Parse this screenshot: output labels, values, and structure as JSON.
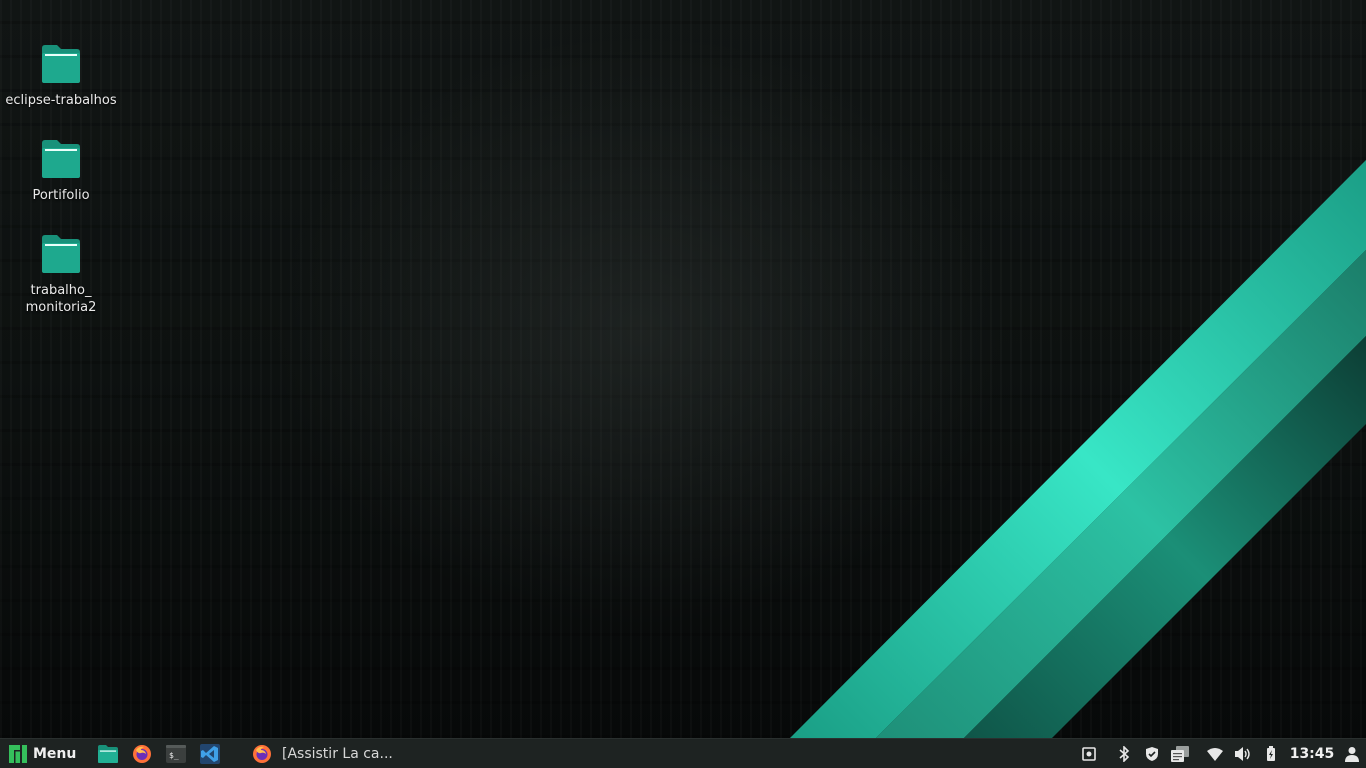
{
  "desktop": {
    "icons": [
      {
        "label": "eclipse-trabalhos",
        "icon": "folder-icon"
      },
      {
        "label": "Portifolio",
        "icon": "folder-icon"
      },
      {
        "label": "trabalho_\nmonitoria2",
        "icon": "folder-icon"
      }
    ]
  },
  "taskbar": {
    "menu_label": "Menu",
    "launchers": [
      {
        "icon": "file-manager-icon"
      },
      {
        "icon": "firefox-icon"
      },
      {
        "icon": "terminal-icon"
      },
      {
        "icon": "vscode-icon"
      }
    ],
    "window_task": {
      "label": "[Assistir La ca...",
      "icon": "firefox-icon"
    },
    "tray": [
      {
        "icon": "screenshot-icon"
      },
      {
        "icon": "bluetooth-icon"
      },
      {
        "icon": "shield-icon"
      },
      {
        "icon": "clipboard-icon"
      },
      {
        "icon": "wifi-icon"
      },
      {
        "icon": "volume-icon"
      },
      {
        "icon": "battery-icon"
      }
    ],
    "clock": "13:45",
    "user_icon": "user-icon"
  },
  "colors": {
    "accent": "#1fa38a",
    "accent_light": "#36e2c2",
    "taskbar_bg": "#1e2322",
    "desktop_bg": "#0d1110"
  }
}
